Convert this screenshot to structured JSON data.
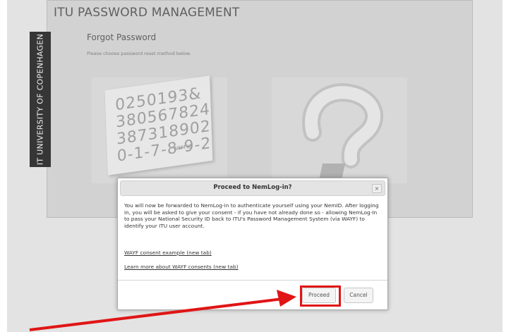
{
  "app": {
    "title": "ITU PASSWORD MANAGEMENT",
    "side_banner": "IT UNIVERSITY OF COPENHAGEN"
  },
  "page": {
    "heading": "Forgot Password",
    "subheading": "Please choose password reset method below."
  },
  "methods": [
    {
      "name": "NemID",
      "card_digits": [
        "0250193&",
        "380567824",
        "387318902",
        "0-1-7-8-9-2"
      ],
      "card_label": "NEM ID"
    },
    {
      "name": "other",
      "icon": "question-mark-icon"
    }
  ],
  "dialog": {
    "title": "Proceed to NemLog-in?",
    "close_icon": "×",
    "body": "You will now be forwarded to NemLog-in to authenticate yourself using your NemID. After logging in, you will be asked to give your consent - if you have not already done so - allowing NemLog-In to pass your National Security ID back to ITU's Password Management System (via WAYF) to identify your ITU user account.",
    "links": [
      "WAYF consent example (new tab)",
      "Learn more about WAYF consents (new tab)"
    ],
    "buttons": {
      "proceed": "Proceed",
      "cancel": "Cancel"
    }
  },
  "annotation": {
    "highlight_color": "#e01515"
  }
}
